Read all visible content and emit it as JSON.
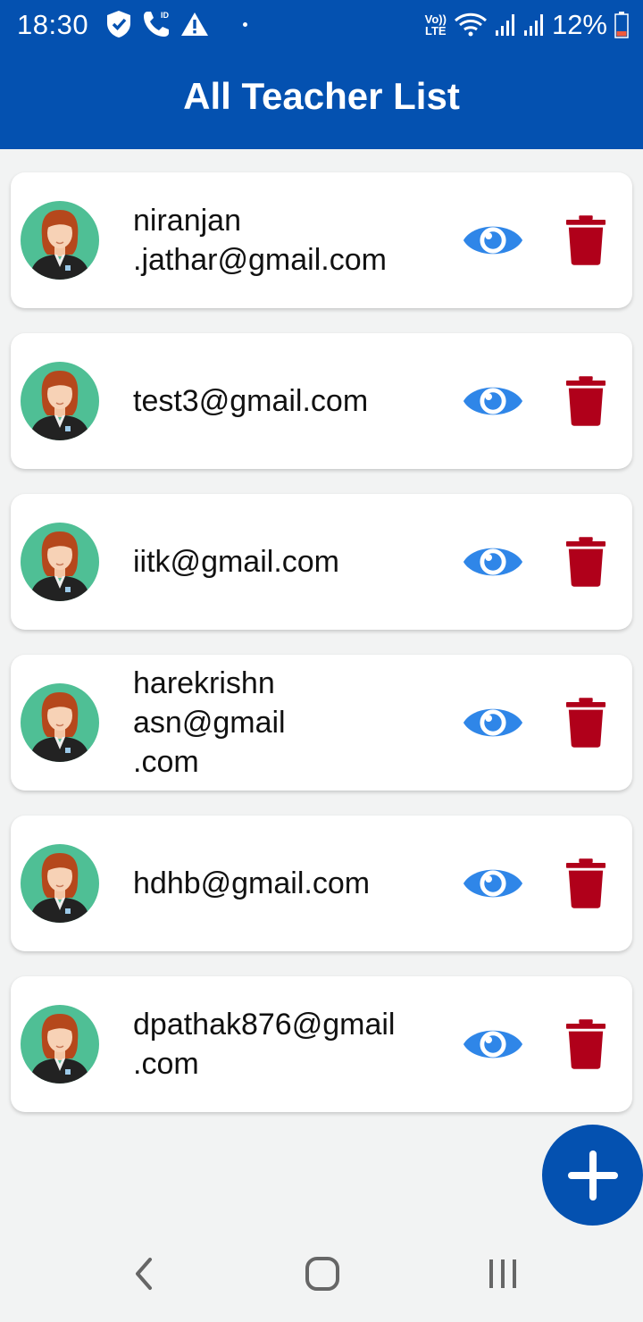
{
  "status": {
    "time": "18:30",
    "left_icons": [
      "shield-check-icon",
      "wifi-calling-icon",
      "warning-icon",
      "dot-icon"
    ],
    "right_icons": [
      "volte-lte-icon",
      "wifi-icon",
      "signal-1-icon",
      "signal-2-icon",
      "battery-low-icon"
    ],
    "volte_top": "Vo))",
    "volte_bottom": "LTE",
    "battery": "12%"
  },
  "header": {
    "title": "All Teacher List",
    "color": "#0451b0"
  },
  "teachers": [
    {
      "email": "niranjan\n.jathar@gmail.com",
      "view_icon": "eye-icon",
      "delete_icon": "trash-icon"
    },
    {
      "email": "test3@gmail.com",
      "view_icon": "eye-icon",
      "delete_icon": "trash-icon"
    },
    {
      "email": "iitk@gmail.com",
      "view_icon": "eye-icon",
      "delete_icon": "trash-icon"
    },
    {
      "email": "harekrishn\nasn@gmail\n.com",
      "view_icon": "eye-icon",
      "delete_icon": "trash-icon"
    },
    {
      "email": "hdhb@gmail.com",
      "view_icon": "eye-icon",
      "delete_icon": "trash-icon"
    },
    {
      "email": "dpathak876@gmail\n.com",
      "view_icon": "eye-icon",
      "delete_icon": "trash-icon"
    }
  ],
  "colors": {
    "accent": "#0451b0",
    "eye": "#2f86e8",
    "trash": "#b0001a",
    "avatar_bg": "#4fbf95"
  },
  "fab": {
    "icon": "plus-icon"
  },
  "navbar": {
    "icons": [
      "back-icon",
      "home-icon",
      "recent-apps-icon"
    ]
  }
}
